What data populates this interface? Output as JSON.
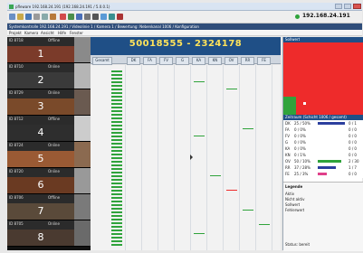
{
  "window": {
    "title": "pfleware 192.168.24.191 (192.168.24.191 / 5.0.0.1)"
  },
  "top_ip": "192.168.24.191",
  "infobar_text": "Systemkontrolle 192.168.24.191 / Videolinie 1 / Kamera 1 / Bewertung: Nebenkanal  1006 / Konfiguration",
  "menu": [
    "Projekt",
    "Kamera",
    "Ansicht",
    "Hilfe",
    "Fenster"
  ],
  "channels": [
    {
      "id": "ID 8718",
      "status": "Offline",
      "number": "1"
    },
    {
      "id": "ID 8710",
      "status": "Online",
      "number": "2"
    },
    {
      "id": "ID 8729",
      "status": "Online",
      "number": "3"
    },
    {
      "id": "ID 8712",
      "status": "Offline",
      "number": "4"
    },
    {
      "id": "ID 8724",
      "status": "Online",
      "number": "5"
    },
    {
      "id": "ID 8720",
      "status": "Online",
      "number": "6"
    },
    {
      "id": "ID 8706",
      "status": "Offline",
      "number": "7"
    },
    {
      "id": "ID 8705",
      "status": "Online",
      "number": "8"
    }
  ],
  "main_header": "50018555 - 2324178",
  "columns": [
    "Gesamt",
    "DK",
    "FA",
    "FV",
    "G",
    "KA",
    "KN",
    "OV",
    "RR",
    "FE"
  ],
  "right_header": "Sollwert",
  "stats_header": "Zeitraum (Schicht 1006 / gesamt)",
  "stats_rows": [
    {
      "label": "DK",
      "value": "25 / 50%",
      "right": "0 / 1"
    },
    {
      "label": "FA",
      "value": "0 / 0%",
      "right": "0 / 0"
    },
    {
      "label": "FV",
      "value": "0 / 0%",
      "right": "0 / 0"
    },
    {
      "label": "G",
      "value": "0 / 0%",
      "right": "0 / 0"
    },
    {
      "label": "KA",
      "value": "0 / 0%",
      "right": "0 / 0"
    },
    {
      "label": "KN",
      "value": "0 / 1%",
      "right": "0 / 0"
    },
    {
      "label": "OV",
      "value": "50 / 10%",
      "right": "2 / 30"
    },
    {
      "label": "RR",
      "value": "37 / 28%",
      "right": "1 / 7"
    },
    {
      "label": "FE",
      "value": "25 / 3%",
      "right": "0 / 0"
    }
  ],
  "legend": {
    "title": "Legende",
    "items": [
      "Aktiv",
      "Nicht aktiv",
      "Sollwert",
      "Fehlerwert"
    ],
    "footer": "Status: bereit"
  },
  "colors": {
    "header_blue": "#1f4f86",
    "header_text": "#ffe35a",
    "green": "#2fa33b",
    "red": "#ee2b2b"
  }
}
